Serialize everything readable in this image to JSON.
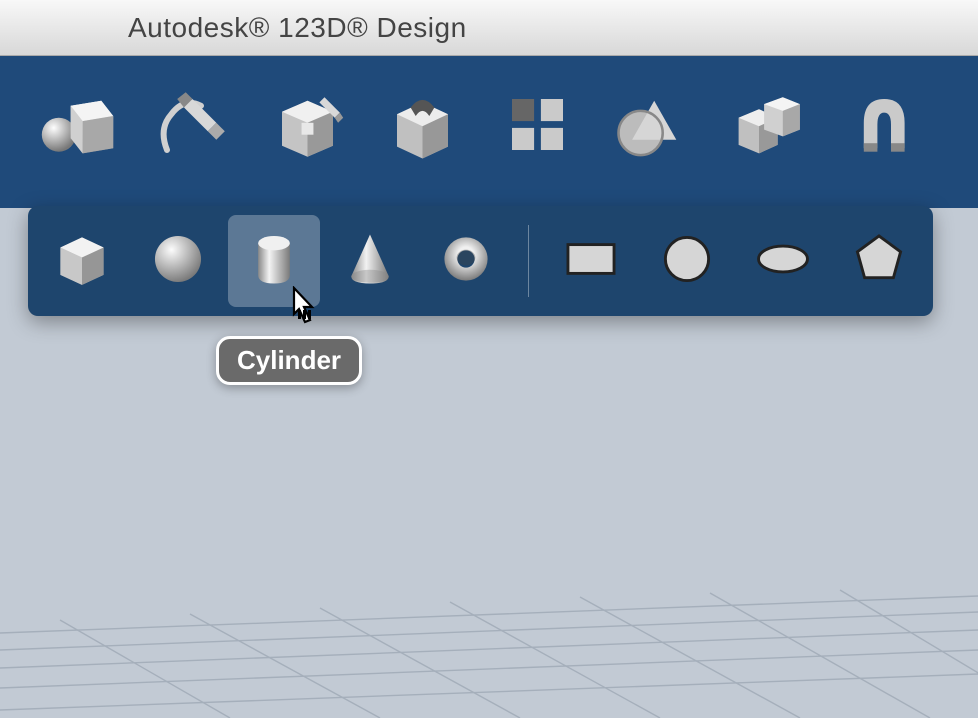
{
  "window": {
    "title": "Autodesk® 123D® Design"
  },
  "main_toolbar": {
    "tools": [
      {
        "name": "primitives",
        "icon": "cube-sphere"
      },
      {
        "name": "sketch",
        "icon": "sketch-pencil"
      },
      {
        "name": "construct",
        "icon": "construct-box"
      },
      {
        "name": "modify",
        "icon": "modify-cut"
      },
      {
        "name": "pattern",
        "icon": "four-squares"
      },
      {
        "name": "grouping",
        "icon": "shapes-group"
      },
      {
        "name": "combine",
        "icon": "cube-combine"
      },
      {
        "name": "snap",
        "icon": "magnet"
      }
    ]
  },
  "primitives_flyout": {
    "solids": [
      {
        "name": "box",
        "icon": "box-3d"
      },
      {
        "name": "sphere",
        "icon": "sphere-3d"
      },
      {
        "name": "cylinder",
        "icon": "cylinder-3d",
        "selected": true
      },
      {
        "name": "cone",
        "icon": "cone-3d"
      },
      {
        "name": "torus",
        "icon": "torus-3d"
      }
    ],
    "sketch_shapes": [
      {
        "name": "rectangle",
        "icon": "rectangle-2d"
      },
      {
        "name": "circle",
        "icon": "circle-2d"
      },
      {
        "name": "ellipse",
        "icon": "ellipse-2d"
      },
      {
        "name": "polygon",
        "icon": "polygon-2d"
      }
    ]
  },
  "tooltip": {
    "label": "Cylinder"
  }
}
